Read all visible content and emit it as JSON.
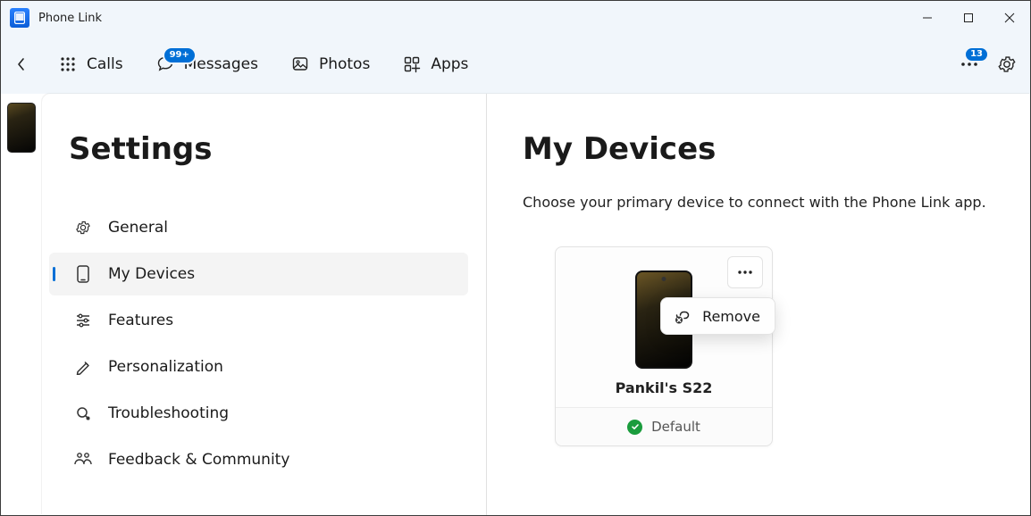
{
  "app": {
    "title": "Phone Link"
  },
  "nav": {
    "calls": "Calls",
    "messages": "Messages",
    "messages_badge": "99+",
    "photos": "Photos",
    "apps": "Apps",
    "notifications_count": "13"
  },
  "settings": {
    "title": "Settings",
    "items": {
      "general": "General",
      "mydevices": "My Devices",
      "features": "Features",
      "personalization": "Personalization",
      "troubleshooting": "Troubleshooting",
      "feedback": "Feedback & Community"
    }
  },
  "devices": {
    "title": "My Devices",
    "subtitle": "Choose your primary device to connect with the Phone Link app.",
    "card": {
      "name": "Pankil's S22",
      "status": "Default"
    },
    "popover": {
      "remove": "Remove"
    }
  }
}
